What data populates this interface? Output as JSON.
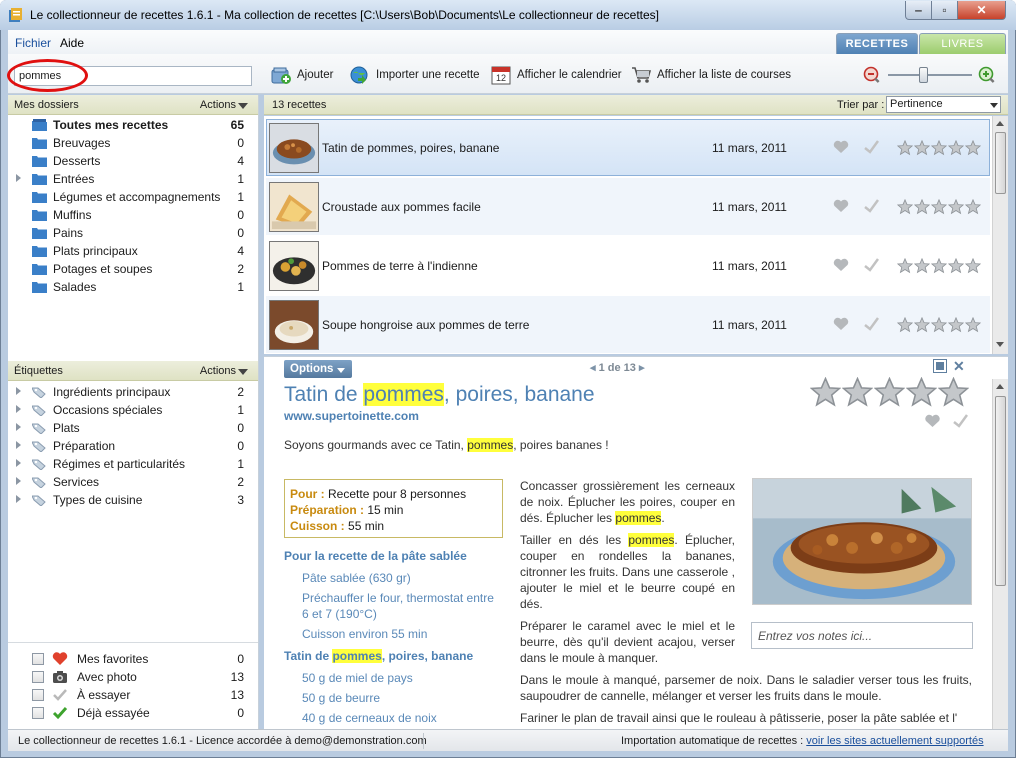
{
  "window": {
    "title": "Le collectionneur de recettes 1.6.1 - Ma collection de recettes [C:\\Users\\Bob\\Documents\\Le collectionneur de recettes]"
  },
  "menu": {
    "fichier": "Fichier",
    "aide": "Aide"
  },
  "tabs": {
    "recettes": "RECETTES",
    "livres": "LIVRES"
  },
  "toolbar": {
    "search_value": "pommes",
    "ajouter": "Ajouter",
    "importer": "Importer une recette",
    "calendrier": "Afficher le calendrier",
    "courses": "Afficher la liste de courses"
  },
  "folders": {
    "header": "Mes dossiers",
    "actions": "Actions",
    "items": [
      {
        "label": "Toutes mes recettes",
        "count": "65"
      },
      {
        "label": "Breuvages",
        "count": "0"
      },
      {
        "label": "Desserts",
        "count": "4"
      },
      {
        "label": "Entrées",
        "count": "1"
      },
      {
        "label": "Légumes et accompagnements",
        "count": "1"
      },
      {
        "label": "Muffins",
        "count": "0"
      },
      {
        "label": "Pains",
        "count": "0"
      },
      {
        "label": "Plats principaux",
        "count": "4"
      },
      {
        "label": "Potages et soupes",
        "count": "2"
      },
      {
        "label": "Salades",
        "count": "1"
      }
    ]
  },
  "tags": {
    "header": "Étiquettes",
    "actions": "Actions",
    "items": [
      {
        "label": "Ingrédients principaux",
        "count": "2"
      },
      {
        "label": "Occasions spéciales",
        "count": "1"
      },
      {
        "label": "Plats",
        "count": "0"
      },
      {
        "label": "Préparation",
        "count": "0"
      },
      {
        "label": "Régimes et particularités",
        "count": "1"
      },
      {
        "label": "Services",
        "count": "2"
      },
      {
        "label": "Types de cuisine",
        "count": "3"
      }
    ]
  },
  "filters": [
    {
      "label": "Mes favorites",
      "count": "0"
    },
    {
      "label": "Avec photo",
      "count": "13"
    },
    {
      "label": "À essayer",
      "count": "13"
    },
    {
      "label": "Déjà essayée",
      "count": "0"
    }
  ],
  "list": {
    "count": "13 recettes",
    "sort_label": "Trier par :",
    "sort_value": "Pertinence",
    "rows": [
      {
        "name": "Tatin de pommes, poires, banane",
        "date": "11 mars, 2011"
      },
      {
        "name": "Croustade aux pommes facile",
        "date": "11 mars, 2011"
      },
      {
        "name": "Pommes de terre à l'indienne",
        "date": "11 mars, 2011"
      },
      {
        "name": "Soupe hongroise aux pommes de terre",
        "date": "11 mars, 2011"
      }
    ]
  },
  "detail": {
    "options": "Options",
    "pager": "1 de 13",
    "title_pre": "Tatin de ",
    "title_hl": "pommes",
    "title_post": ", poires, banane",
    "site": "www.supertoinette.com",
    "intro_pre": "Soyons gourmands avec ce Tatin, ",
    "intro_hl": "pommes",
    "intro_post": ", poires bananes !",
    "pour_label": "Pour :",
    "pour_value": "Recette pour 8 personnes",
    "prep_label": "Préparation :",
    "prep_value": "15 min",
    "cuisson_label": "Cuisson :",
    "cuisson_value": "55 min",
    "ing_head1": "Pour la recette de la pâte sablée",
    "ing1": [
      "Pâte sablée (630 gr)",
      "Préchauffer le four, thermostat entre 6 et 7 (190°C)",
      "Cuisson environ 55 min"
    ],
    "ing_head2_pre": "Tatin de ",
    "ing_head2_hl": "pommes",
    "ing_head2_post": ", poires, banane",
    "ing2": [
      "50 g de miel de pays",
      "50 g de beurre",
      "40 g de cerneaux de noix"
    ],
    "step1_pre": "Concasser grossièrement les cerneaux de noix. Éplucher les poires, couper en dés. Éplucher les ",
    "step1_hl": "pommes",
    "step1_post": ".",
    "step2_pre": "Tailler en dés les ",
    "step2_hl": "pommes",
    "step2_post": ". Éplucher, couper en rondelles la bananes, citronner les fruits. Dans une casserole , ajouter le miel et le beurre coupé en dés.",
    "step3": "Préparer le caramel avec le miel et le beurre, dès qu'il devient acajou, verser dans le moule à manquer.",
    "step4": "Dans le moule à manqué, parsemer de noix. Dans le saladier verser tous les fruits, saupoudrer de cannelle, mélanger et verser les fruits dans le moule.",
    "step5": "Fariner le plan de travail ainsi que le rouleau à pâtisserie, poser la pâte sablée et l'",
    "notes_placeholder": "Entrez vos notes ici..."
  },
  "status": {
    "left": "Le collectionneur de recettes 1.6.1 - Licence accordée à demo@demonstration.com",
    "right_pre": "Importation automatique de recettes : ",
    "right_link": "voir les sites actuellement supportés"
  },
  "colors": {
    "accent": "#4e81b3",
    "highlight": "#ffff3c",
    "search_circle": "#e01010"
  }
}
